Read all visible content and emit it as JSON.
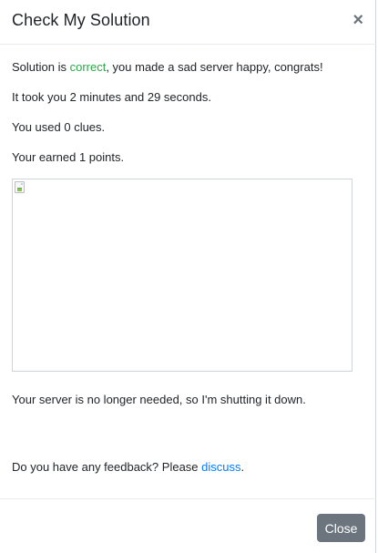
{
  "modal": {
    "title": "Check My Solution",
    "close_symbol": "×",
    "close_icon": "close-icon"
  },
  "body": {
    "solution_prefix": "Solution is ",
    "solution_status": "correct",
    "solution_suffix": ", you made a sad server happy, congrats!",
    "time_text": "It took you 2 minutes and 29 seconds.",
    "clues_text": "You used 0 clues.",
    "points_text": "Your earned 1 points.",
    "image_icon": "broken-image-icon",
    "shutdown_text": "Your server is no longer needed, so I'm shutting it down.",
    "feedback_prefix": "Do you have any feedback? Please ",
    "feedback_link": "discuss",
    "feedback_suffix": "."
  },
  "footer": {
    "close_label": "Close"
  },
  "colors": {
    "success": "#28a745",
    "link": "#007bff",
    "button": "#6c757d"
  }
}
